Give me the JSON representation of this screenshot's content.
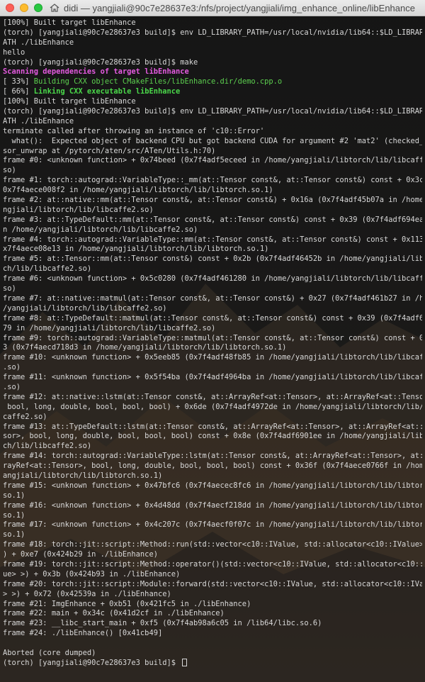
{
  "window": {
    "title": "didi — yangjiali@90c7e28637e3:/nfs/project/yangjiali/img_enhance_online/libEnhance",
    "colors": {
      "close": "#fc5f57",
      "minimize": "#fdbc2e",
      "maximize": "#28c841"
    }
  },
  "terminal": {
    "colors": {
      "default": "#d8d8d8",
      "magenta": "#e45be0",
      "green": "#5ccf4f",
      "background": "#151515"
    },
    "lines": [
      {
        "text": "[100%] Built target libEnhance",
        "style": ""
      },
      {
        "text": "(torch) [yangjiali@90c7e28637e3 build]$ env LD_LIBRARY_PATH=/usr/local/nvidia/lib64::$LD_LIBRARY_P",
        "style": ""
      },
      {
        "text": "ATH ./libEnhance",
        "style": ""
      },
      {
        "text": "hello",
        "style": ""
      },
      {
        "text": "(torch) [yangjiali@90c7e28637e3 build]$ make",
        "style": ""
      },
      {
        "text": "Scanning dependencies of target libEnhance",
        "style": "magenta"
      },
      {
        "text": "[ 33%] Building CXX object CMakeFiles/libEnhance.dir/demo.cpp.o",
        "style": "green-partial"
      },
      {
        "text": "[ 66%] Linking CXX executable libEnhance",
        "style": "greenb-partial"
      },
      {
        "text": "[100%] Built target libEnhance",
        "style": ""
      },
      {
        "text": "(torch) [yangjiali@90c7e28637e3 build]$ env LD_LIBRARY_PATH=/usr/local/nvidia/lib64::$LD_LIBRARY_P",
        "style": ""
      },
      {
        "text": "ATH ./libEnhance",
        "style": ""
      },
      {
        "text": "terminate called after throwing an instance of 'c10::Error'",
        "style": ""
      },
      {
        "text": "  what():  Expected object of backend CPU but got backend CUDA for argument #2 'mat2' (checked_ten",
        "style": ""
      },
      {
        "text": "sor_unwrap at /pytorch/aten/src/ATen/Utils.h:70)",
        "style": ""
      },
      {
        "text": "frame #0: <unknown function> + 0x74beed (0x7f4adf5eceed in /home/yangjiali/libtorch/lib/libcaffe2.",
        "style": ""
      },
      {
        "text": "so)",
        "style": ""
      },
      {
        "text": "frame #1: torch::autograd::VariableType::_mm(at::Tensor const&, at::Tensor const&) const + 0x3c2 (",
        "style": ""
      },
      {
        "text": "0x7f4aece008f2 in /home/yangjiali/libtorch/lib/libtorch.so.1)",
        "style": ""
      },
      {
        "text": "frame #2: at::native::mm(at::Tensor const&, at::Tensor const&) + 0x16a (0x7f4adf45b07a in /home/ya",
        "style": ""
      },
      {
        "text": "ngjiali/libtorch/lib/libcaffe2.so)",
        "style": ""
      },
      {
        "text": "frame #3: at::TypeDefault::mm(at::Tensor const&, at::Tensor const&) const + 0x39 (0x7f4adf694ea9 i",
        "style": ""
      },
      {
        "text": "n /home/yangjiali/libtorch/lib/libcaffe2.so)",
        "style": ""
      },
      {
        "text": "frame #4: torch::autograd::VariableType::mm(at::Tensor const&, at::Tensor const&) const + 0x113 (0",
        "style": ""
      },
      {
        "text": "x7f4aece08e13 in /home/yangjiali/libtorch/lib/libtorch.so.1)",
        "style": ""
      },
      {
        "text": "frame #5: at::Tensor::mm(at::Tensor const&) const + 0x2b (0x7f4adf46452b in /home/yangjiali/libtor",
        "style": ""
      },
      {
        "text": "ch/lib/libcaffe2.so)",
        "style": ""
      },
      {
        "text": "frame #6: <unknown function> + 0x5c0280 (0x7f4adf461280 in /home/yangjiali/libtorch/lib/libcaffe2.",
        "style": ""
      },
      {
        "text": "so)",
        "style": ""
      },
      {
        "text": "frame #7: at::native::matmul(at::Tensor const&, at::Tensor const&) + 0x27 (0x7f4adf461b27 in /home",
        "style": ""
      },
      {
        "text": "/yangjiali/libtorch/lib/libcaffe2.so)",
        "style": ""
      },
      {
        "text": "frame #8: at::TypeDefault::matmul(at::Tensor const&, at::Tensor const&) const + 0x39 (0x7f4adf695f",
        "style": ""
      },
      {
        "text": "79 in /home/yangjiali/libtorch/lib/libcaffe2.so)",
        "style": ""
      },
      {
        "text": "frame #9: torch::autograd::VariableType::matmul(at::Tensor const&, at::Tensor const&) const + 0x11",
        "style": ""
      },
      {
        "text": "3 (0x7f4aecd718d3 in /home/yangjiali/libtorch/lib/libtorch.so.1)",
        "style": ""
      },
      {
        "text": "frame #10: <unknown function> + 0x5eeb85 (0x7f4adf48fb85 in /home/yangjiali/libtorch/lib/libcaffe2",
        "style": ""
      },
      {
        "text": ".so)",
        "style": ""
      },
      {
        "text": "frame #11: <unknown function> + 0x5f54ba (0x7f4adf4964ba in /home/yangjiali/libtorch/lib/libcaffe2",
        "style": ""
      },
      {
        "text": ".so)",
        "style": ""
      },
      {
        "text": "frame #12: at::native::lstm(at::Tensor const&, at::ArrayRef<at::Tensor>, at::ArrayRef<at::Tensor>,",
        "style": ""
      },
      {
        "text": " bool, long, double, bool, bool, bool) + 0x6de (0x7f4adf4972de in /home/yangjiali/libtorch/lib/lib",
        "style": ""
      },
      {
        "text": "caffe2.so)",
        "style": ""
      },
      {
        "text": "frame #13: at::TypeDefault::lstm(at::Tensor const&, at::ArrayRef<at::Tensor>, at::ArrayRef<at::Ten",
        "style": ""
      },
      {
        "text": "sor>, bool, long, double, bool, bool, bool) const + 0x8e (0x7f4adf6901ee in /home/yangjiali/libtor",
        "style": ""
      },
      {
        "text": "ch/lib/libcaffe2.so)",
        "style": ""
      },
      {
        "text": "frame #14: torch::autograd::VariableType::lstm(at::Tensor const&, at::ArrayRef<at::Tensor>, at::Ar",
        "style": ""
      },
      {
        "text": "rayRef<at::Tensor>, bool, long, double, bool, bool, bool) const + 0x36f (0x7f4aece0766f in /home/y",
        "style": ""
      },
      {
        "text": "angjiali/libtorch/lib/libtorch.so.1)",
        "style": ""
      },
      {
        "text": "frame #15: <unknown function> + 0x47bfc6 (0x7f4aecec8fc6 in /home/yangjiali/libtorch/lib/libtorch.",
        "style": ""
      },
      {
        "text": "so.1)",
        "style": ""
      },
      {
        "text": "frame #16: <unknown function> + 0x4d48dd (0x7f4aecf218dd in /home/yangjiali/libtorch/lib/libtorch.",
        "style": ""
      },
      {
        "text": "so.1)",
        "style": ""
      },
      {
        "text": "frame #17: <unknown function> + 0x4c207c (0x7f4aecf0f07c in /home/yangjiali/libtorch/lib/libtorch.",
        "style": ""
      },
      {
        "text": "so.1)",
        "style": ""
      },
      {
        "text": "frame #18: torch::jit::script::Method::run(std::vector<c10::IValue, std::allocator<c10::IValue> >&",
        "style": ""
      },
      {
        "text": ") + 0xe7 (0x424b29 in ./libEnhance)",
        "style": ""
      },
      {
        "text": "frame #19: torch::jit::script::Method::operator()(std::vector<c10::IValue, std::allocator<c10::IVal",
        "style": ""
      },
      {
        "text": "ue> >) + 0x3b (0x424b93 in ./libEnhance)",
        "style": ""
      },
      {
        "text": "frame #20: torch::jit::script::Module::forward(std::vector<c10::IValue, std::allocator<c10::IValue",
        "style": ""
      },
      {
        "text": "> >) + 0x72 (0x42539a in ./libEnhance)",
        "style": ""
      },
      {
        "text": "frame #21: ImgEnhance + 0xb51 (0x421fc5 in ./libEnhance)",
        "style": ""
      },
      {
        "text": "frame #22: main + 0x34c (0x41d2cf in ./libEnhance)",
        "style": ""
      },
      {
        "text": "frame #23: __libc_start_main + 0xf5 (0x7f4ab98a6c05 in /lib64/libc.so.6)",
        "style": ""
      },
      {
        "text": "frame #24: ./libEnhance() [0x41cb49]",
        "style": ""
      },
      {
        "text": "",
        "style": ""
      },
      {
        "text": "Aborted (core dumped)",
        "style": ""
      },
      {
        "text": "(torch) [yangjiali@90c7e28637e3 build]$ ",
        "style": "prompt"
      }
    ]
  }
}
